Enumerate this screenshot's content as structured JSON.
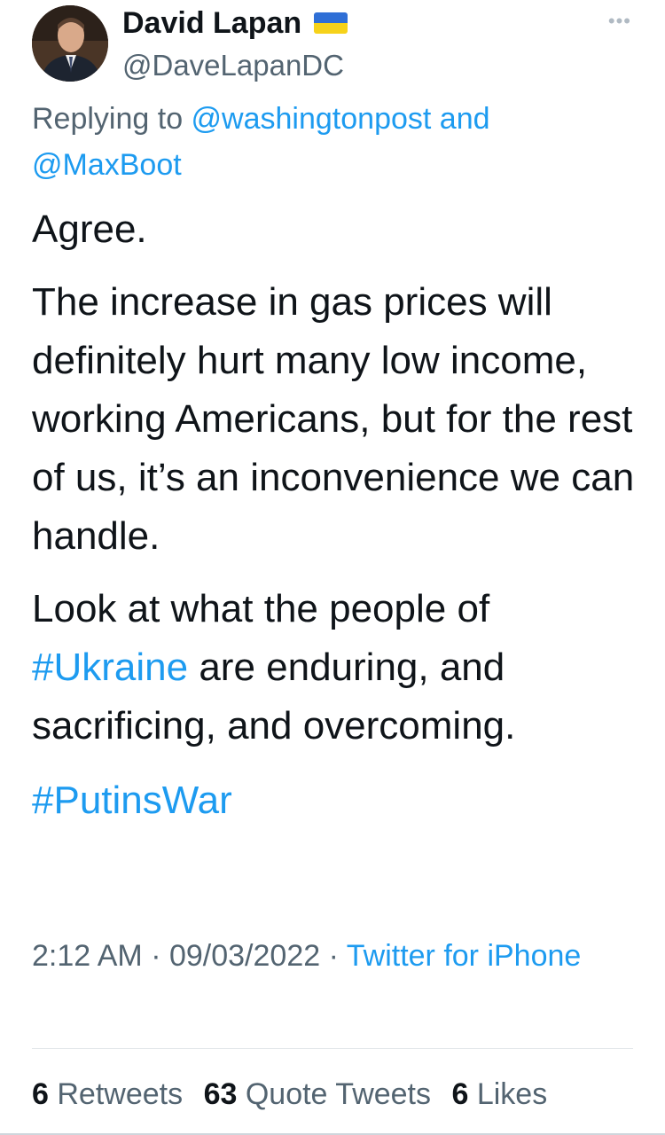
{
  "author": {
    "display_name": "David Lapan",
    "handle": "@DaveLapanDC",
    "flag_icon": "ukraine-flag-icon"
  },
  "more_icon": "ellipsis-icon",
  "reply": {
    "prefix": "Replying to ",
    "mention1": "@washingtonpost",
    "joiner": " and",
    "mention2": "@MaxBoot"
  },
  "body": {
    "para1": "Agree.",
    "para2": "The increase in gas prices will definitely hurt many low income, working Americans, but for the rest of us, it’s an inconvenience we can handle.",
    "para3_pre": "Look at what the people of ",
    "para3_hashtag": "#Ukraine",
    "para3_post": " are enduring, and sacrificing, and overcoming.",
    "hashtag2": "#PutinsWar"
  },
  "meta": {
    "time": "2:12 AM",
    "sep1": " · ",
    "date": "09/03/2022",
    "sep2": " · ",
    "source": "Twitter for iPhone"
  },
  "stats": {
    "retweets_count": "6",
    "retweets_label": "Retweets",
    "quotes_count": "63",
    "quotes_label": "Quote Tweets",
    "likes_count": "6",
    "likes_label": "Likes"
  },
  "colors": {
    "link": "#1d9bf0",
    "secondary_text": "#536471",
    "primary_text": "#0f1419",
    "flag_blue": "#2f6fd6",
    "flag_yellow": "#f6d21a"
  }
}
